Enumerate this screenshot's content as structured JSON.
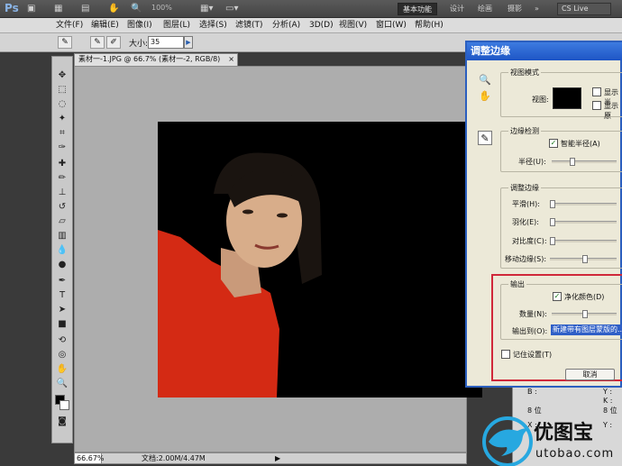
{
  "app": {
    "logo": "Ps",
    "zoom_select": "100%"
  },
  "workspace": {
    "active": "基本功能",
    "items": [
      "设计",
      "绘画",
      "摄影"
    ],
    "more": "»",
    "cslive": "CS Live"
  },
  "menu": [
    "文件(F)",
    "编辑(E)",
    "图像(I)",
    "图层(L)",
    "选择(S)",
    "滤镜(T)",
    "分析(A)",
    "3D(D)",
    "视图(V)",
    "窗口(W)",
    "帮助(H)"
  ],
  "options": {
    "size_label": "大小:",
    "size_value": "35"
  },
  "document": {
    "tab": "素材一-1.JPG @ 66.7% (素材一-2, RGB/8)",
    "close": "×"
  },
  "status": {
    "zoom": "66.67%",
    "doc": "文档:2.00M/4.47M",
    "arrow": "▶"
  },
  "info_panel": {
    "b_label": "B :",
    "bit1": "8 位",
    "bit2": "8 位",
    "x_label": "X :",
    "y_label": "Y :",
    "k_label": "K :",
    "y2": "Y :"
  },
  "dialog": {
    "title": "调整边缘",
    "view_mode": {
      "group": "视图模式",
      "view_label": "视图:",
      "show1": "显示半",
      "show2": "显示原"
    },
    "edge": {
      "group": "边缘检测",
      "smart_radius": "智能半径(A)",
      "radius": "半径(U):"
    },
    "adjust": {
      "group": "调整边缘",
      "smooth": "平滑(H):",
      "feather": "羽化(E):",
      "contrast": "对比度(C):",
      "shift": "移动边缘(S):"
    },
    "output": {
      "group": "输出",
      "decontaminate": "净化颜色(D)",
      "amount": "数量(N):",
      "output_to": "输出到(O):",
      "output_value": "新建带有图层蒙版的..."
    },
    "remember": "记住设置(T)",
    "cancel": "取消"
  },
  "watermark": {
    "name": "优图宝",
    "url": "utobao.com"
  }
}
